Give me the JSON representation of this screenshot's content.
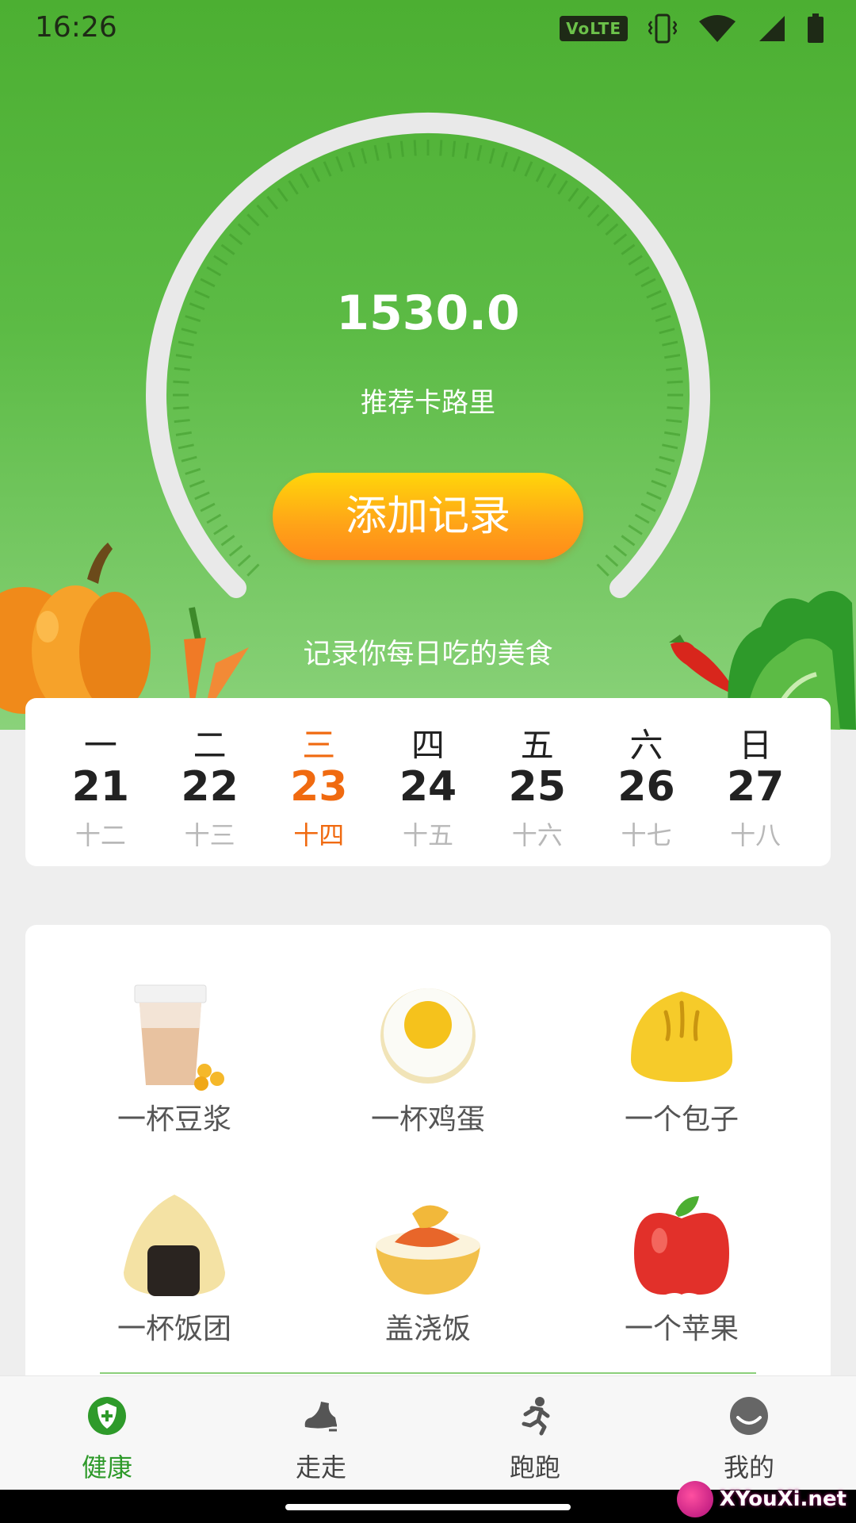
{
  "status_bar": {
    "time": "16:26",
    "volte": "VoLTE",
    "icons": [
      "volte-icon",
      "vibrate-icon",
      "wifi-icon",
      "cell-signal-icon",
      "battery-icon"
    ]
  },
  "hero": {
    "calorie_value": "1530.0",
    "calorie_label": "推荐卡路里",
    "add_button_label": "添加记录",
    "tagline": "记录你每日吃的美食"
  },
  "week": {
    "selected_index": 2,
    "days": [
      {
        "weekday": "一",
        "date": "21",
        "lunar": "十二"
      },
      {
        "weekday": "二",
        "date": "22",
        "lunar": "十三"
      },
      {
        "weekday": "三",
        "date": "23",
        "lunar": "十四"
      },
      {
        "weekday": "四",
        "date": "24",
        "lunar": "十五"
      },
      {
        "weekday": "五",
        "date": "25",
        "lunar": "十六"
      },
      {
        "weekday": "六",
        "date": "26",
        "lunar": "十七"
      },
      {
        "weekday": "日",
        "date": "27",
        "lunar": "十八"
      }
    ]
  },
  "foods": [
    {
      "label": "一杯豆浆",
      "icon": "soy-milk-icon"
    },
    {
      "label": "一杯鸡蛋",
      "icon": "egg-icon"
    },
    {
      "label": "一个包子",
      "icon": "bun-icon"
    },
    {
      "label": "一杯饭团",
      "icon": "rice-ball-icon"
    },
    {
      "label": "盖浇饭",
      "icon": "rice-bowl-icon"
    },
    {
      "label": "一个苹果",
      "icon": "apple-icon"
    }
  ],
  "nav": {
    "tabs": [
      {
        "label": "健康",
        "icon": "health-shield-icon",
        "active": true
      },
      {
        "label": "走走",
        "icon": "walk-shoe-icon",
        "active": false
      },
      {
        "label": "跑跑",
        "icon": "running-person-icon",
        "active": false
      },
      {
        "label": "我的",
        "icon": "profile-smile-icon",
        "active": false
      }
    ]
  },
  "watermark": {
    "text": "XYouXi.net"
  },
  "colors": {
    "hero_green": "#4caf32",
    "accent_orange": "#f06a10",
    "button_yellow": "#ffd60a",
    "nav_active_green": "#2e9a2a"
  }
}
